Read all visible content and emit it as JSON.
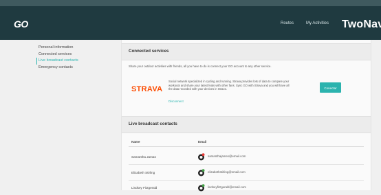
{
  "header": {
    "logo": "GO",
    "nav": [
      "Routes",
      "My Activities"
    ],
    "brand": "TwoNav"
  },
  "sidebar": {
    "items": [
      {
        "label": "Personal information",
        "active": false
      },
      {
        "label": "Connected services",
        "active": false
      },
      {
        "label": "Live broadcast contacts",
        "active": true
      },
      {
        "label": "Emergency contacts",
        "active": false
      }
    ]
  },
  "connected_services": {
    "title": "Connected services",
    "intro": "Share your outdoor activities with friends, all you have to do is connect your GO account to any other service.",
    "service": {
      "name": "STRAVA",
      "description": "Social network specialized in cycling and running. Strava provides lots of data to compare your workouts and share your latest feats with other fans. Sync GO with Strava and you will have all the data recorded with your devices in Strava.",
      "disconnect_label": "Disconnect",
      "connect_label": "Conectar"
    }
  },
  "live_broadcast": {
    "title": "Live broadcast contacts",
    "columns": [
      "Name",
      "Email"
    ],
    "rows": [
      {
        "name": "Samantha Jamas",
        "email": "samanthajames@email.com"
      },
      {
        "name": "Elizabeth Stirling",
        "email": "elizabethstirling@email.com"
      },
      {
        "name": "Lindsey Fitzgerald",
        "email": "lindseyfitzgerald@email.com"
      }
    ]
  },
  "colors": {
    "navbar": "#1f3a40",
    "accent": "#2ab5b0",
    "strava": "#fc4c02"
  }
}
